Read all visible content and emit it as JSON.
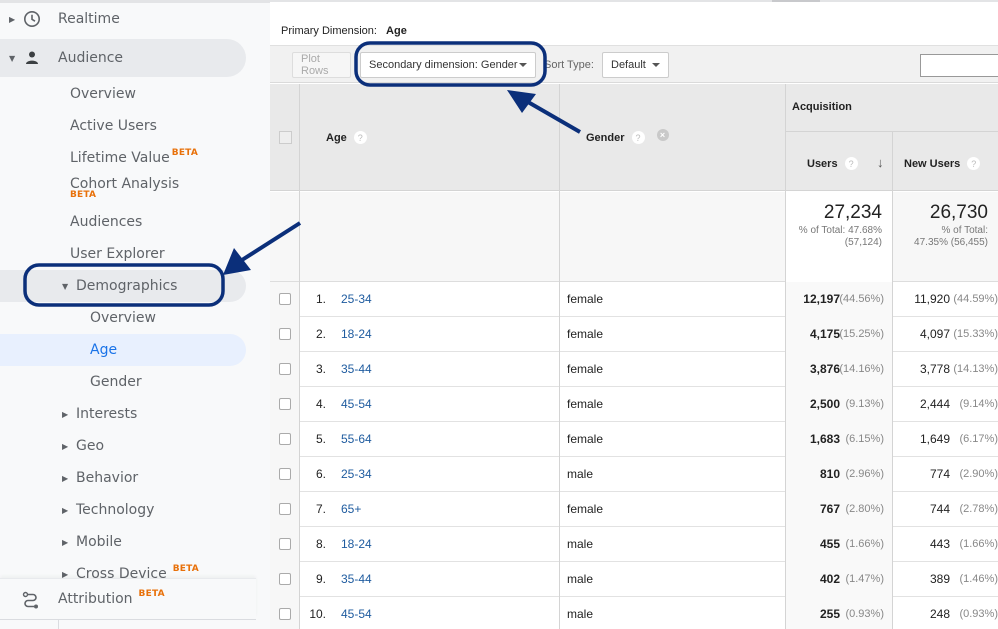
{
  "sidebar": {
    "realtime": {
      "label": "Realtime",
      "icon": "clock-icon"
    },
    "audience": {
      "label": "Audience",
      "icon": "person-icon"
    },
    "audience_items": [
      {
        "label": "Overview"
      },
      {
        "label": "Active Users"
      },
      {
        "label": "Lifetime Value",
        "badge": "BETA"
      },
      {
        "label": "Cohort Analysis",
        "badge": "BETA"
      },
      {
        "label": "Audiences"
      },
      {
        "label": "User Explorer"
      }
    ],
    "demographics": {
      "label": "Demographics",
      "items": [
        {
          "label": "Overview"
        },
        {
          "label": "Age",
          "active": true
        },
        {
          "label": "Gender"
        }
      ]
    },
    "collapsed_items": [
      {
        "label": "Interests"
      },
      {
        "label": "Geo"
      },
      {
        "label": "Behavior"
      },
      {
        "label": "Technology"
      },
      {
        "label": "Mobile"
      },
      {
        "label": "Cross Device",
        "badge": "BETA"
      }
    ],
    "attribution": {
      "label": "Attribution",
      "badge": "BETA",
      "icon": "attribution-icon"
    }
  },
  "report": {
    "primary_dimension_label": "Primary Dimension:",
    "primary_dimension_value": "Age",
    "toolbar": {
      "plot_rows": "Plot Rows",
      "secondary_dimension": "Secondary dimension: Gender",
      "sort_type_label": "Sort Type:",
      "sort_type_value": "Default",
      "search_value": ""
    },
    "columns": {
      "age": "Age",
      "gender": "Gender",
      "group": "Acquisition",
      "users": "Users",
      "new_users": "New Users"
    },
    "totals": {
      "users": "27,234",
      "users_sub1": "% of Total: 47.68%",
      "users_sub2": "(57,124)",
      "new_users": "26,730",
      "new_users_sub1": "% of Total:",
      "new_users_sub2": "47.35% (56,455)"
    },
    "rows": [
      {
        "idx": "1.",
        "age": "25-34",
        "gender": "female",
        "users": "12,197",
        "users_pct": "(44.56%)",
        "new_users": "11,920",
        "new_users_pct": "(44.59%)"
      },
      {
        "idx": "2.",
        "age": "18-24",
        "gender": "female",
        "users": "4,175",
        "users_pct": "(15.25%)",
        "new_users": "4,097",
        "new_users_pct": "(15.33%)"
      },
      {
        "idx": "3.",
        "age": "35-44",
        "gender": "female",
        "users": "3,876",
        "users_pct": "(14.16%)",
        "new_users": "3,778",
        "new_users_pct": "(14.13%)"
      },
      {
        "idx": "4.",
        "age": "45-54",
        "gender": "female",
        "users": "2,500",
        "users_pct": "(9.13%)",
        "new_users": "2,444",
        "new_users_pct": "(9.14%)"
      },
      {
        "idx": "5.",
        "age": "55-64",
        "gender": "female",
        "users": "1,683",
        "users_pct": "(6.15%)",
        "new_users": "1,649",
        "new_users_pct": "(6.17%)"
      },
      {
        "idx": "6.",
        "age": "25-34",
        "gender": "male",
        "users": "810",
        "users_pct": "(2.96%)",
        "new_users": "774",
        "new_users_pct": "(2.90%)"
      },
      {
        "idx": "7.",
        "age": "65+",
        "gender": "female",
        "users": "767",
        "users_pct": "(2.80%)",
        "new_users": "744",
        "new_users_pct": "(2.78%)"
      },
      {
        "idx": "8.",
        "age": "18-24",
        "gender": "male",
        "users": "455",
        "users_pct": "(1.66%)",
        "new_users": "443",
        "new_users_pct": "(1.66%)"
      },
      {
        "idx": "9.",
        "age": "35-44",
        "gender": "male",
        "users": "402",
        "users_pct": "(1.47%)",
        "new_users": "389",
        "new_users_pct": "(1.46%)"
      },
      {
        "idx": "10.",
        "age": "45-54",
        "gender": "male",
        "users": "255",
        "users_pct": "(0.93%)",
        "new_users": "248",
        "new_users_pct": "(0.93%)"
      }
    ]
  },
  "colors": {
    "annotation": "#0b2f7a",
    "link": "#1e5b9f",
    "beta": "#e8710a",
    "active_nav": "#1a73e8"
  }
}
